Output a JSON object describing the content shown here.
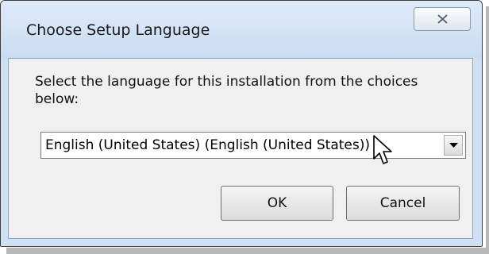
{
  "dialog": {
    "title": "Choose Setup Language",
    "prompt": "Select the language for this installation from the choices below:",
    "language_select": {
      "selected": "English (United States) (English (United States))"
    },
    "buttons": {
      "ok_label": "OK",
      "cancel_label": "Cancel"
    },
    "icons": {
      "close": "close-icon",
      "dropdown": "chevron-down-icon",
      "cursor": "mouse-pointer-icon"
    }
  }
}
